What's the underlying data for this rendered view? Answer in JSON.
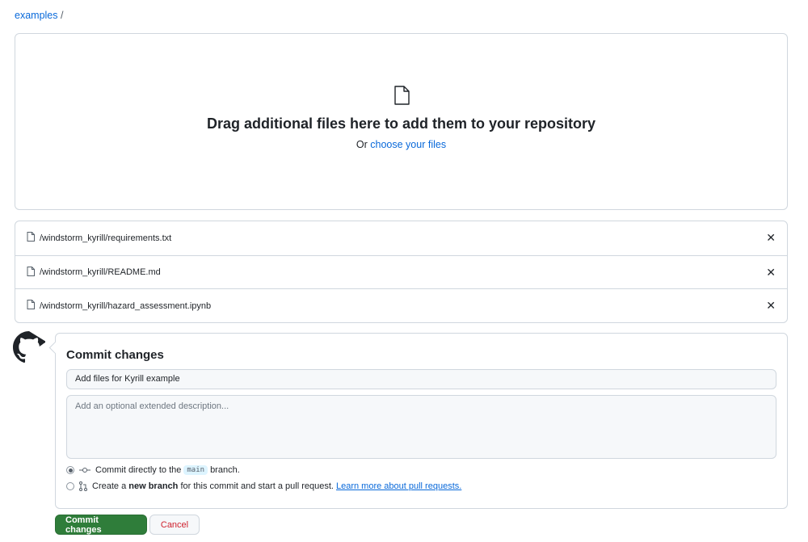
{
  "breadcrumb": {
    "repo": "examples",
    "separator": "/"
  },
  "dropzone": {
    "title": "Drag additional files here to add them to your repository",
    "prefix": "Or",
    "link": "choose your files"
  },
  "files": [
    {
      "name": "/windstorm_kyrill/requirements.txt"
    },
    {
      "name": "/windstorm_kyrill/README.md"
    },
    {
      "name": "/windstorm_kyrill/hazard_assessment.ipynb"
    }
  ],
  "commit": {
    "title": "Commit changes",
    "summary_value": "Add files for Kyrill example",
    "description_placeholder": "Add an optional extended description...",
    "option_direct": {
      "before": "Commit directly to the",
      "branch": "main",
      "after": "branch."
    },
    "option_new": {
      "before": "Create a",
      "bold": "new branch",
      "after": "for this commit and start a pull request.",
      "link": "Learn more about pull requests."
    },
    "submit_label": "Commit changes",
    "cancel_label": "Cancel"
  },
  "colors": {
    "primary": "#2f7d3a",
    "link": "#0969da",
    "danger": "#cf222e"
  }
}
